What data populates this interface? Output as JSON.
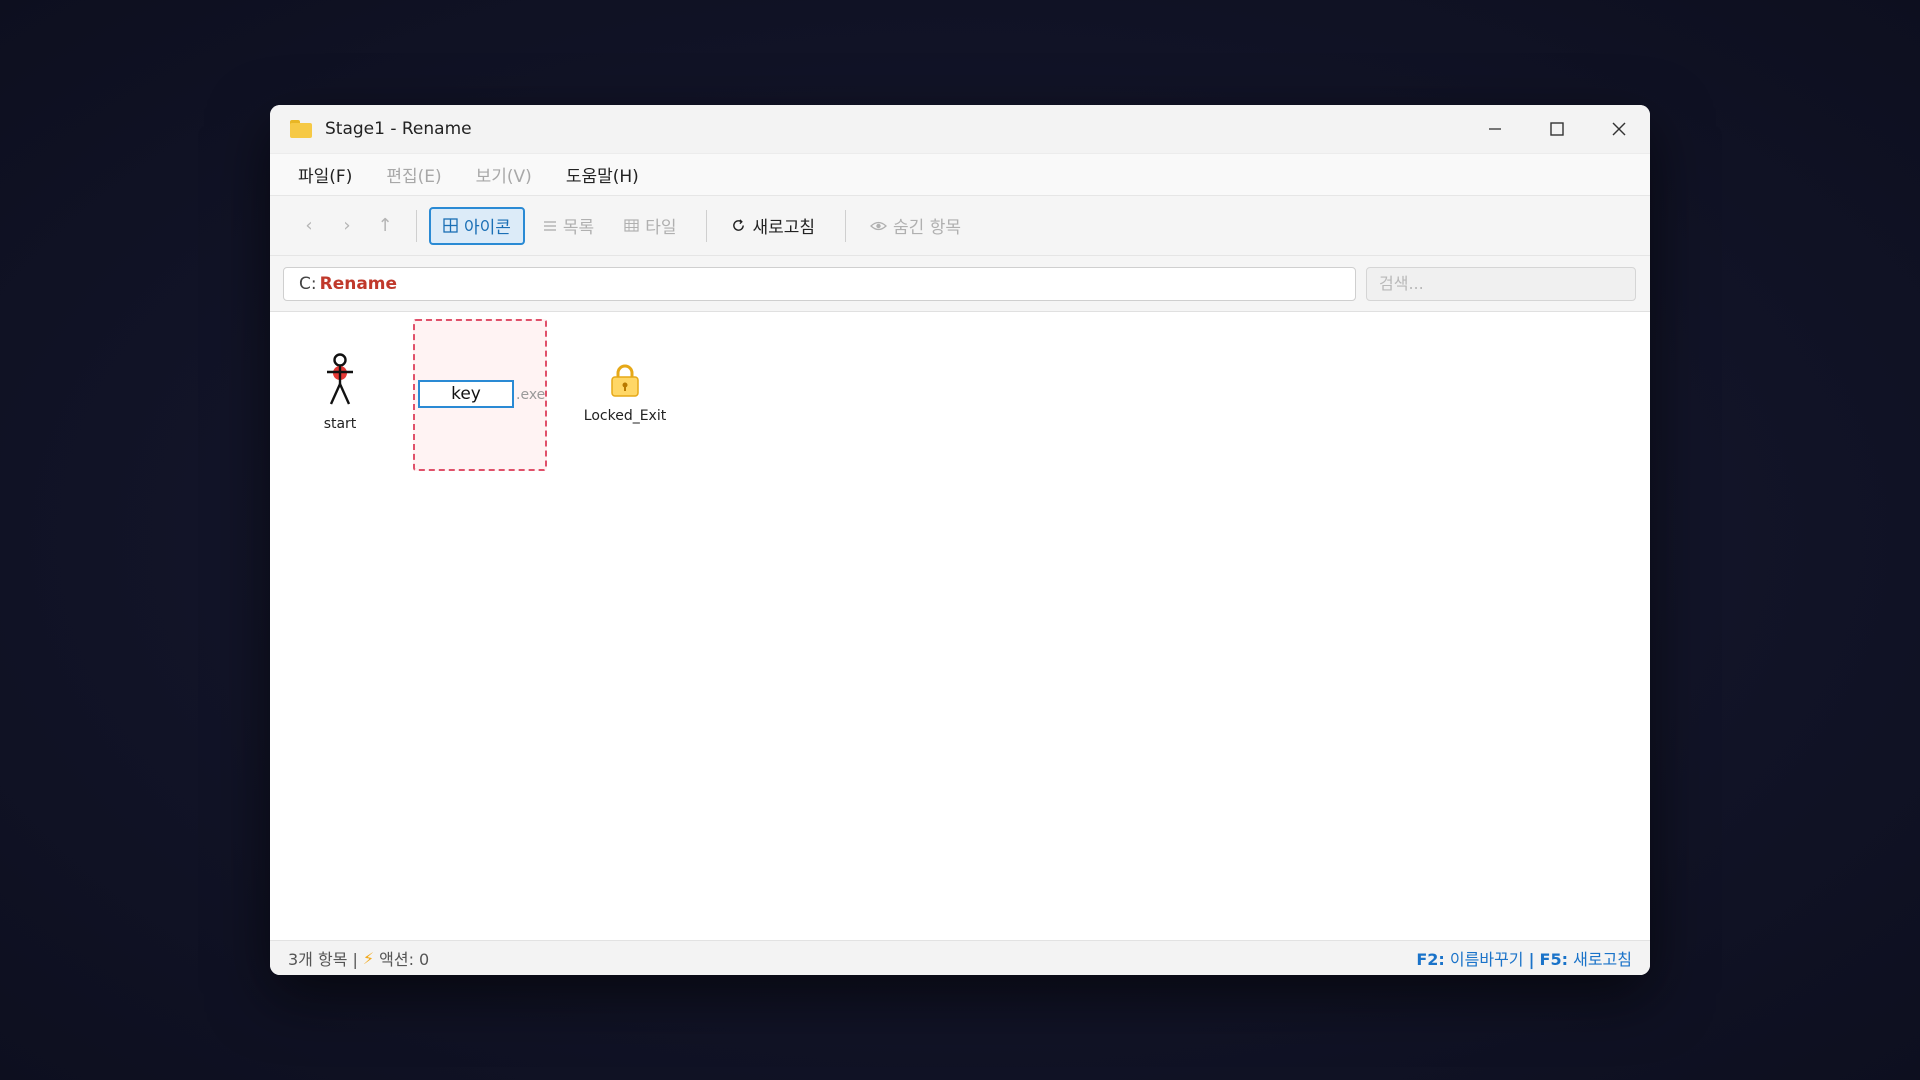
{
  "window": {
    "title": "Stage1 - Rename",
    "icon": "folder-icon"
  },
  "menu": {
    "file": "파일(F)",
    "edit": "편집(E)",
    "view": "보기(V)",
    "help": "도움말(H)"
  },
  "toolbar": {
    "back": "‹",
    "forward": "›",
    "up": "↑",
    "icons_view": "아이콘",
    "list_view": "목록",
    "tile_view": "타일",
    "refresh": "새로고침",
    "hidden_items": "숨긴 항목"
  },
  "address": {
    "drive": "C:",
    "folder": "Rename"
  },
  "search": {
    "placeholder": "검색..."
  },
  "files": [
    {
      "name": "start",
      "icon": "stick-figure-icon"
    },
    {
      "name": "key",
      "extension": ".exe",
      "icon": "key-icon",
      "renaming": true
    },
    {
      "name": "Locked_Exit",
      "icon": "lock-icon"
    }
  ],
  "status": {
    "items": "3개 항목 |",
    "actions": "액션: 0",
    "hint_f2_key": "F2:",
    "hint_f2_text": "이름바꾸기",
    "hint_sep": "|",
    "hint_f5_key": "F5:",
    "hint_f5_text": "새로고침"
  },
  "colors": {
    "accent": "#2a8ad4",
    "address_folder": "#c0392b",
    "rename_border": "#e0506a",
    "status_hint": "#1a73c9"
  }
}
